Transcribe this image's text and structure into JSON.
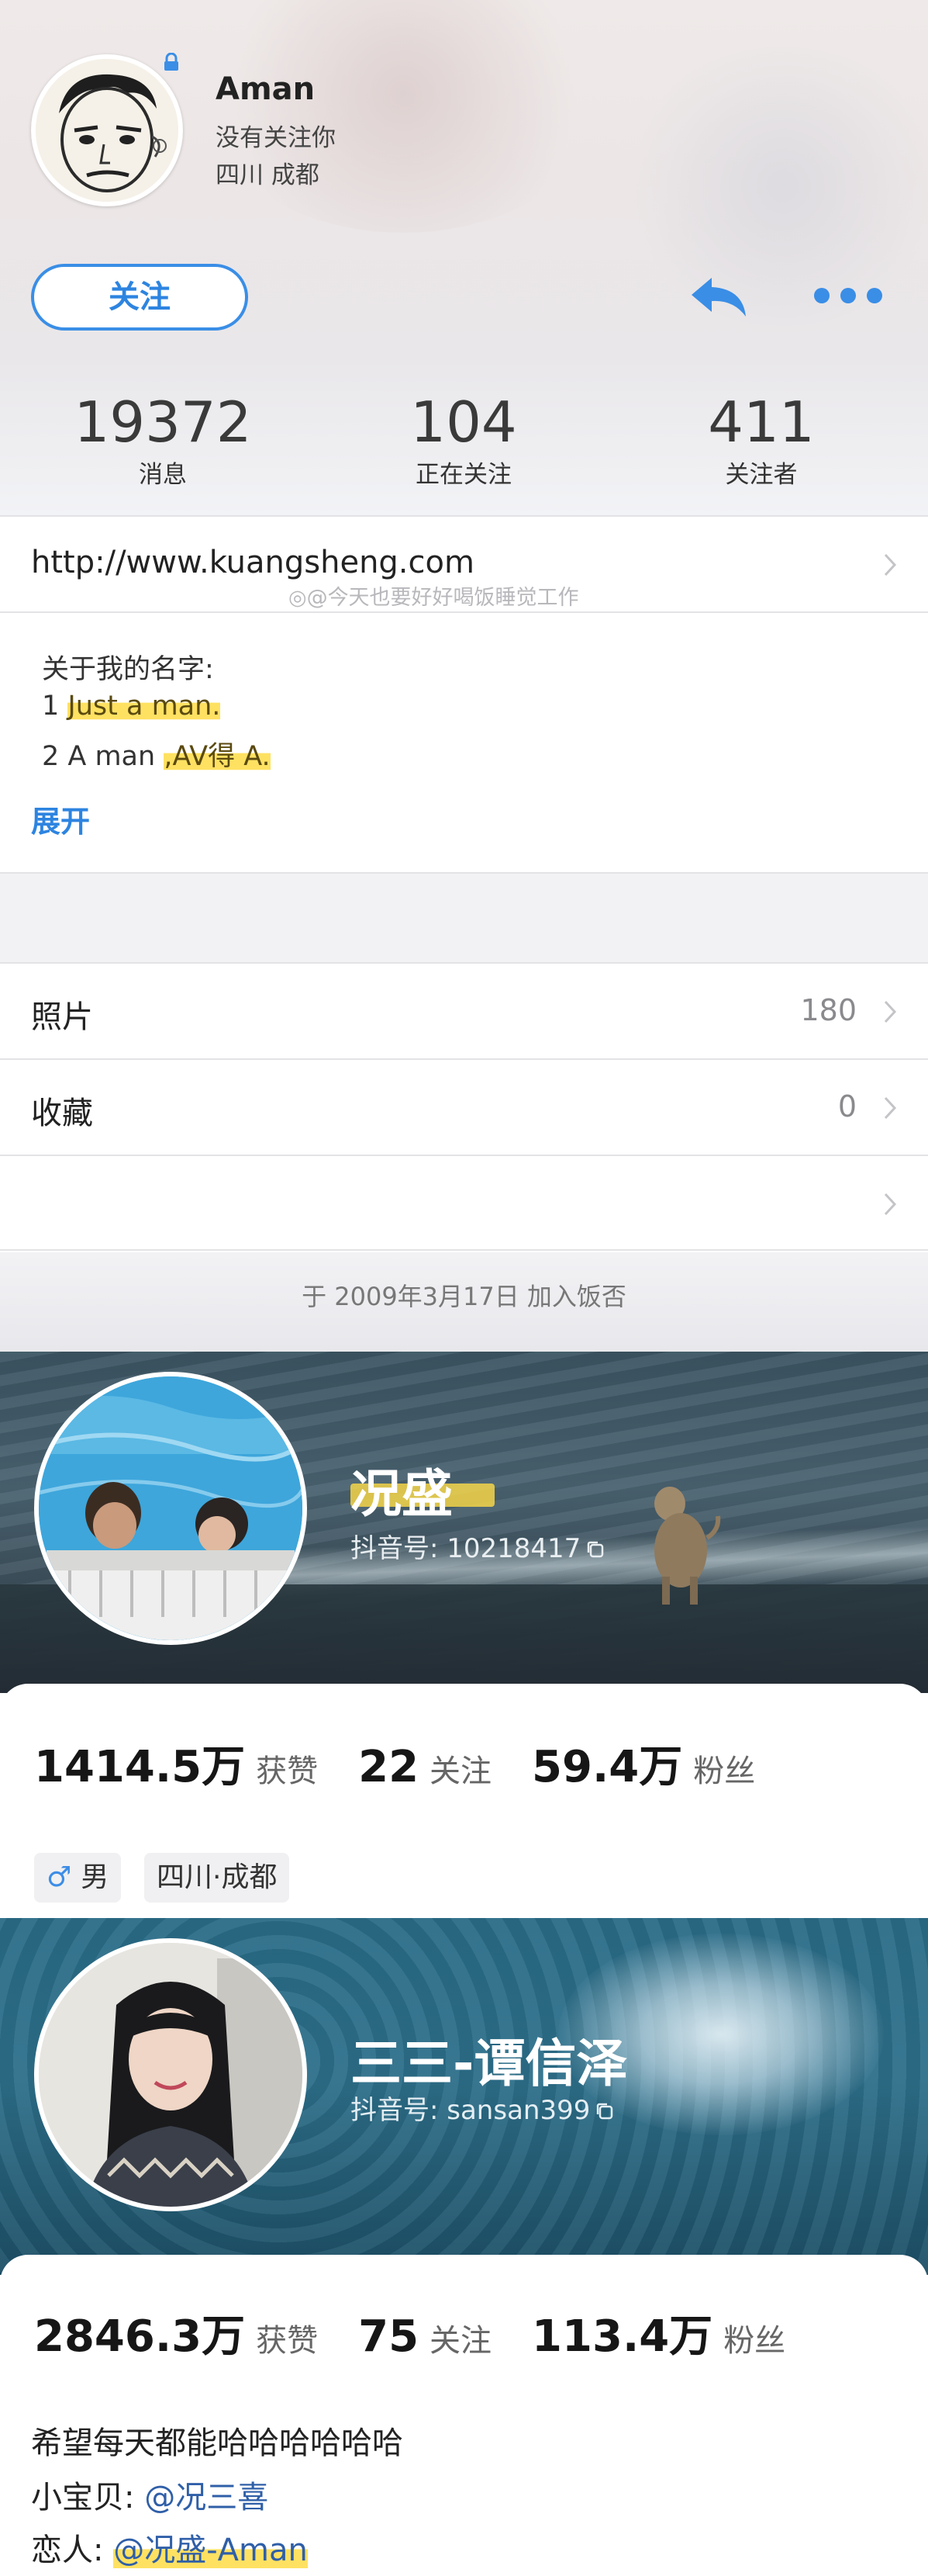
{
  "fanfou": {
    "name": "Aman",
    "follow_status": "没有关注你",
    "location": "四川 成都",
    "follow_button": "关注",
    "stats": [
      {
        "value": "19372",
        "label": "消息"
      },
      {
        "value": "104",
        "label": "正在关注"
      },
      {
        "value": "411",
        "label": "关注者"
      }
    ],
    "url": "http://www.kuangsheng.com",
    "watermark": "@今天也要好好喝饭睡觉工作",
    "bio": {
      "line1": "关于我的名字:",
      "line2_prefix": "1 ",
      "line2_hl": "Just a man.",
      "line3_prefix": "2 A man ",
      "line3_hl": ",AV得 A."
    },
    "expand_label": "展开",
    "list": [
      {
        "label": "照片",
        "value": "180"
      },
      {
        "label": "收藏",
        "value": "0"
      },
      {
        "label": "",
        "value": ""
      }
    ],
    "joined": "于 2009年3月17日 加入饭否"
  },
  "douyin1": {
    "name": "况盛",
    "id": "抖音号: 10218417",
    "stats": [
      {
        "value": "1414.5万",
        "label": "获赞"
      },
      {
        "value": "22",
        "label": "关注"
      },
      {
        "value": "59.4万",
        "label": "粉丝"
      }
    ],
    "tags": {
      "gender_symbol": "♂",
      "gender": "男",
      "location": "四川·成都"
    }
  },
  "douyin2": {
    "name": "三三-谭信泽",
    "id": "抖音号: sansan399",
    "stats": [
      {
        "value": "2846.3万",
        "label": "获赞"
      },
      {
        "value": "75",
        "label": "关注"
      },
      {
        "value": "113.4万",
        "label": "粉丝"
      }
    ],
    "bio": {
      "line1": "希望每天都能哈哈哈哈哈哈",
      "line2_label": "小宝贝: ",
      "line2_mention": "@况三喜",
      "line3_label": "恋人: ",
      "line3_mention": "@况盛-Aman"
    }
  },
  "colors": {
    "accent_blue": "#2d84e0",
    "highlight": "#ffdc46"
  },
  "icons": [
    "lock-icon",
    "reply-icon",
    "more-icon",
    "chevron-right-icon",
    "copy-icon",
    "male-icon"
  ]
}
